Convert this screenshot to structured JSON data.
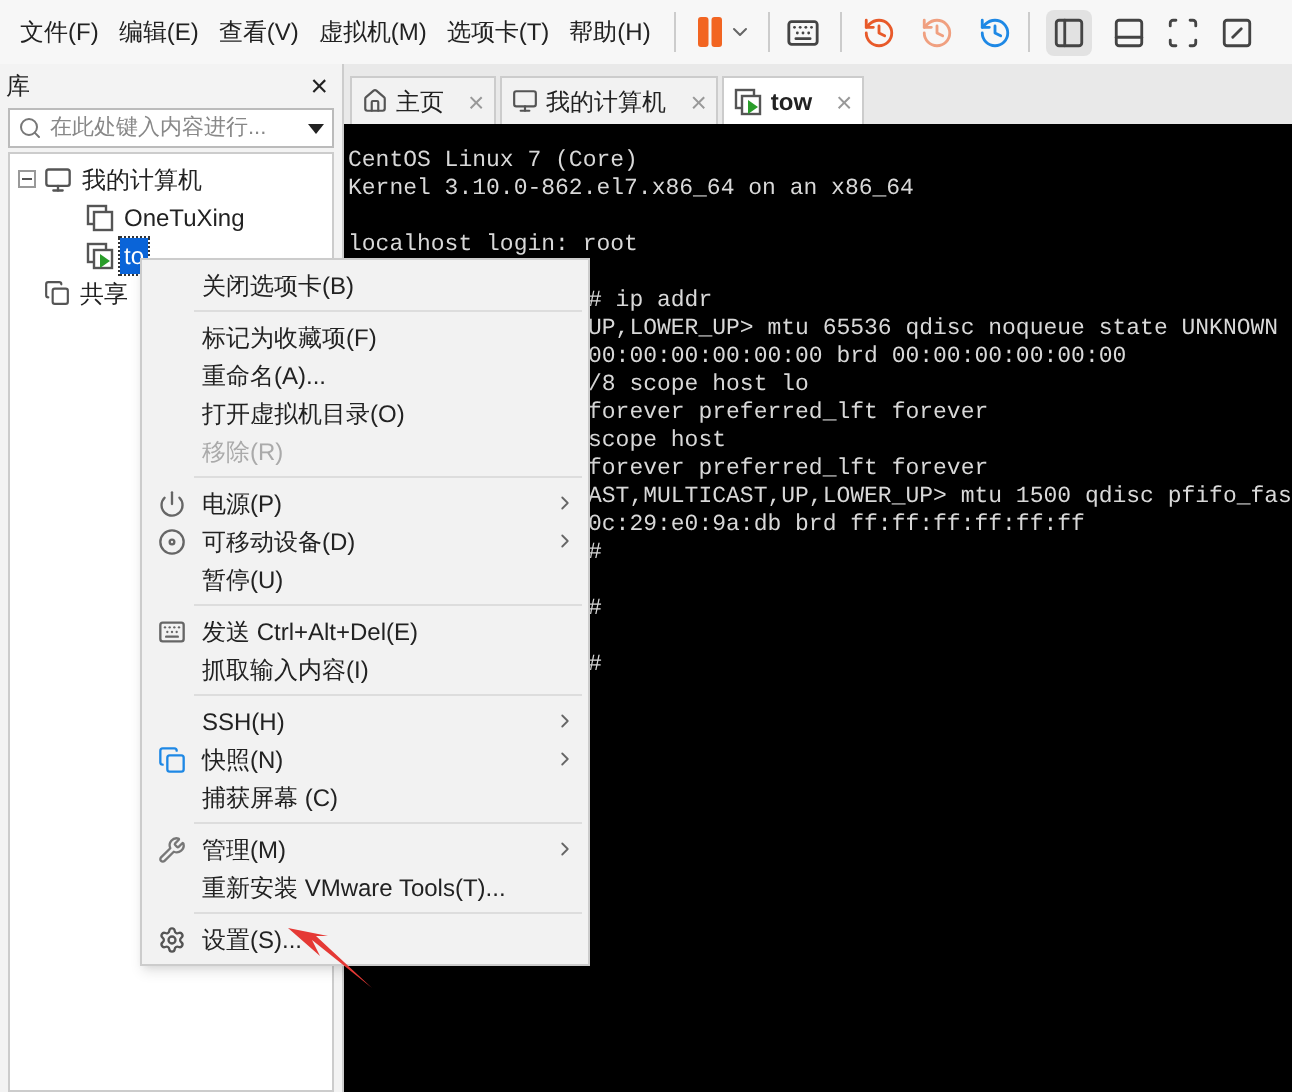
{
  "menu_bar": [
    "文件(F)",
    "编辑(E)",
    "查看(V)",
    "虚拟机(M)",
    "选项卡(T)",
    "帮助(H)"
  ],
  "library": {
    "title": "库",
    "close": "×",
    "search": {
      "placeholder": "在此处键入内容进行..."
    },
    "tree": [
      {
        "label": "我的计算机",
        "expanded": true,
        "selected": false,
        "children": [
          {
            "label": "OneTuXing",
            "selected": false,
            "running": false
          },
          {
            "label": "to",
            "selected": true,
            "running": true
          }
        ]
      },
      {
        "label": "共享",
        "selected": false
      }
    ]
  },
  "tabs": [
    {
      "label": "主页",
      "selected": false,
      "close": "×"
    },
    {
      "label": "我的计算机",
      "selected": false,
      "close": "×"
    },
    {
      "label": "tow",
      "selected": true,
      "close": "×"
    }
  ],
  "terminal": {
    "blocks": [
      [
        "CentOS Linux 7 (Core)",
        "Kernel 3.10.0-862.el7.x86_64 on an x86_64"
      ],
      [
        "localhost login: root"
      ]
    ],
    "partial_blocks": [
      [
        "# ip addr",
        "UP,LOWER_UP> mtu 65536 qdisc noqueue state UNKNOWN",
        "00:00:00:00:00:00 brd 00:00:00:00:00:00",
        "/8 scope host lo",
        "forever preferred_lft forever",
        "scope host",
        "forever preferred_lft forever",
        "AST,MULTICAST,UP,LOWER_UP> mtu 1500 qdisc pfifo_fas",
        "0c:29:e0:9a:db brd ff:ff:ff:ff:ff:ff",
        "#"
      ],
      [
        "#"
      ],
      [
        "#"
      ]
    ]
  },
  "context_menu": {
    "groups": [
      [
        {
          "label": "关闭选项卡(B)",
          "disabled": false,
          "submenu": false
        }
      ],
      [
        {
          "label": "标记为收藏项(F)",
          "disabled": false,
          "submenu": false
        },
        {
          "label": "重命名(A)...",
          "disabled": false,
          "submenu": false
        },
        {
          "label": "打开虚拟机目录(O)",
          "disabled": false,
          "submenu": false
        },
        {
          "label": "移除(R)",
          "disabled": true,
          "submenu": false
        }
      ],
      [
        {
          "label": "电源(P)",
          "disabled": false,
          "submenu": true
        },
        {
          "label": "可移动设备(D)",
          "disabled": false,
          "submenu": true
        },
        {
          "label": "暂停(U)",
          "disabled": false,
          "submenu": false
        }
      ],
      [
        {
          "label": "发送 Ctrl+Alt+Del(E)",
          "disabled": false,
          "submenu": false
        },
        {
          "label": "抓取输入内容(I)",
          "disabled": false,
          "submenu": false
        }
      ],
      [
        {
          "label": "SSH(H)",
          "disabled": false,
          "submenu": true
        },
        {
          "label": "快照(N)",
          "disabled": false,
          "submenu": true
        },
        {
          "label": "捕获屏幕 (C)",
          "disabled": false,
          "submenu": false
        }
      ],
      [
        {
          "label": "管理(M)",
          "disabled": false,
          "submenu": true
        },
        {
          "label": "重新安装 VMware Tools(T)...",
          "disabled": false,
          "submenu": false
        }
      ],
      [
        {
          "label": "设置(S)...",
          "disabled": false,
          "submenu": false
        }
      ]
    ]
  }
}
